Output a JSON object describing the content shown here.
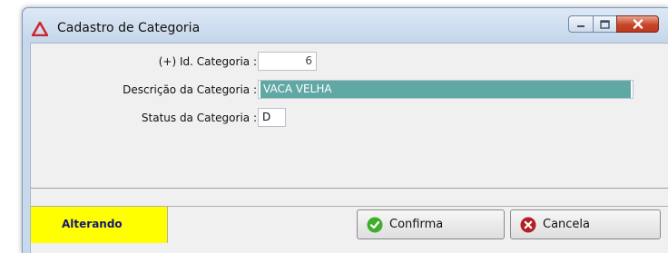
{
  "window": {
    "title": "Cadastro de Categoria"
  },
  "form": {
    "id_label": "(+) Id. Categoria :",
    "id_value": "6",
    "descricao_label": "Descrição da Categoria :",
    "descricao_value": "VACA VELHA",
    "status_label": "Status da Categoria :",
    "status_value": "D"
  },
  "footer": {
    "mode": "Alterando",
    "confirm_label": "Confirma",
    "cancel_label": "Cancela"
  },
  "colors": {
    "mode_background": "#ffff00",
    "selection_background": "#5fa8a4",
    "confirm_icon": "#3fae2a",
    "cancel_icon": "#b41f24"
  },
  "icons": {
    "app": "red-triangle-icon",
    "minimize": "minimize-icon",
    "maximize": "maximize-icon",
    "close": "close-icon",
    "confirm": "check-circle-icon",
    "cancel": "x-circle-icon"
  }
}
